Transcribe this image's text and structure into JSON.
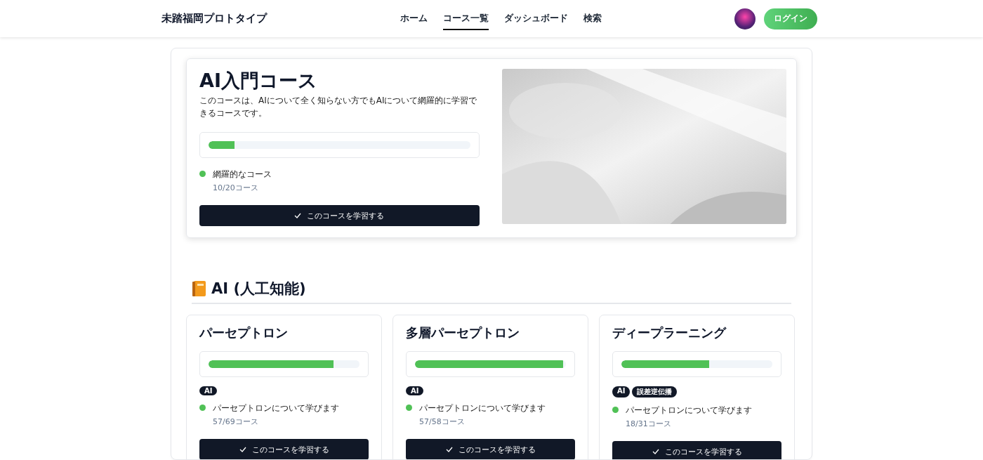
{
  "header": {
    "brand": "未踏福岡プロトタイプ",
    "nav": [
      {
        "label": "ホーム",
        "selected": false
      },
      {
        "label": "コース一覧",
        "selected": true
      },
      {
        "label": "ダッシュボード",
        "selected": false
      },
      {
        "label": "検索",
        "selected": false
      }
    ],
    "login": "ログイン"
  },
  "hero": {
    "title": "AI入門コース",
    "description": "このコースは、AIについて全く知らない方でもAIについて網羅的に学習できるコースです。",
    "level": 0.1,
    "status": "網羅的なコース",
    "count": "10/20コース",
    "button": "このコースを学習する"
  },
  "section": {
    "title": "AI (人工知能)",
    "courses": [
      {
        "title": "パーセプトロン",
        "level": 0.83,
        "tags": [
          "AI"
        ],
        "status": "パーセプトロンについて学びます",
        "count": "57/69コース",
        "button": "このコースを学習する"
      },
      {
        "title": "多層パーセプトロン",
        "level": 0.98,
        "tags": [
          "AI"
        ],
        "status": "パーセプトロンについて学びます",
        "count": "57/58コース",
        "button": "このコースを学習する"
      },
      {
        "title": "ディープラーニング",
        "level": 0.58,
        "tags": [
          "AI",
          "誤差逆伝播"
        ],
        "status": "パーセプトロンについて学びます",
        "count": "18/31コース",
        "button": "このコースを学習する"
      }
    ]
  }
}
